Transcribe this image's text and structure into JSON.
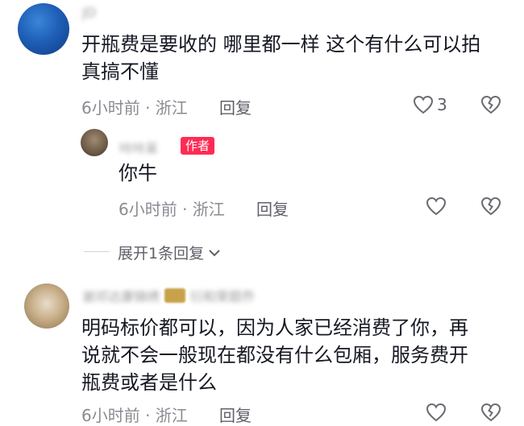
{
  "comments": [
    {
      "username": "JD",
      "text_line1": "开瓶费是要收的 哪里都一样 这个有什么可以拍",
      "text_line2": "真搞不懂",
      "time_location": "6小时前 · 浙江",
      "reply_label": "回复",
      "likes": "3",
      "reply": {
        "username": "咔咔呆",
        "badge": "作者",
        "text": "你牛",
        "time_location": "6小时前 · 浙江",
        "reply_label": "回复"
      },
      "expand_label": "展开1条回复"
    },
    {
      "username": "谢邓达康锦绣",
      "username_suffix": "衍和荣题乔",
      "text_line1": "明码标价都可以，因为人家已经消费了你，再",
      "text_line2": "说就不会一般现在都没有什么包厢，服务费开",
      "text_line3": "瓶费或者是什么",
      "time_location": "6小时前 · 浙江",
      "reply_label": "回复"
    }
  ],
  "colors": {
    "author_badge": "#fe2c55",
    "meta_text": "#8a8b91"
  },
  "icons": [
    "heart-outline-icon",
    "broken-heart-icon",
    "chevron-down-icon"
  ]
}
